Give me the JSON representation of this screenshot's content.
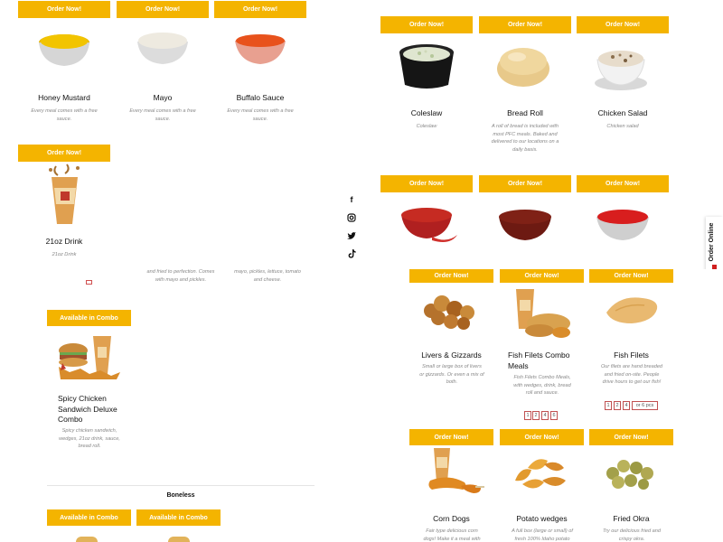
{
  "colors": {
    "accent": "#f4b400"
  },
  "order_now": "Order Now!",
  "available_combo": "Available in Combo",
  "left_top": {
    "items": [
      {
        "name": "Honey Mustard",
        "desc": "Every meal comes with a free sauce."
      },
      {
        "name": "Mayo",
        "desc": "Every meal comes with a free sauce."
      },
      {
        "name": "Buffalo Sauce",
        "desc": "Every meal comes with a free sauce."
      }
    ],
    "drink": {
      "name": "21oz Drink",
      "desc": "21oz Drink"
    },
    "partial_desc_1": "and fried to perfection. Comes with mayo and pickles.",
    "partial_desc_2": "mayo, pickles, lettuce, tomato and cheese."
  },
  "right_top": {
    "items": [
      {
        "name": "Coleslaw",
        "desc": "Coleslaw"
      },
      {
        "name": "Bread Roll",
        "desc": "A roll of bread is included with most PFC meals. Baked and delivered to our locations on a daily basis."
      },
      {
        "name": "Chicken Salad",
        "desc": "Chicken salad"
      }
    ]
  },
  "social": [
    "facebook-icon",
    "instagram-icon",
    "twitter-icon",
    "tiktok-icon"
  ],
  "order_online": "Order Online",
  "combo": {
    "name": "Spicy Chicken Sandwich Deluxe Combo",
    "desc": "Spicy chicken sandwich, wedges, 21oz drink, sauce, bread roll."
  },
  "boneless": "Boneless",
  "right_bottom": {
    "row1": [
      {
        "name": "Livers & Gizzards",
        "desc": "Small or large box of livers or gizzards. Or even a mix of both."
      },
      {
        "name": "Fish Filets Combo Meals",
        "desc": "Fish Filets Combo Meals, with wedges, drink, bread roll and sauce."
      },
      {
        "name": "Fish Filets",
        "desc": "Our filets are hand breaded and fried on-site. People drive hours to get our fish!"
      }
    ],
    "pager1": [
      "1",
      "2",
      "4",
      "6"
    ],
    "pager2": [
      "1",
      "2",
      "4",
      "or 6 pcs"
    ],
    "row2": [
      {
        "name": "Corn Dogs",
        "desc": "Fair type delicious corn dogs! Make it a meal with"
      },
      {
        "name": "Potato wedges",
        "desc": "A full box (large or small) of fresh 100% Idaho potato"
      },
      {
        "name": "Fried Okra",
        "desc": "Try our delicious fried and crispy okra."
      }
    ]
  }
}
